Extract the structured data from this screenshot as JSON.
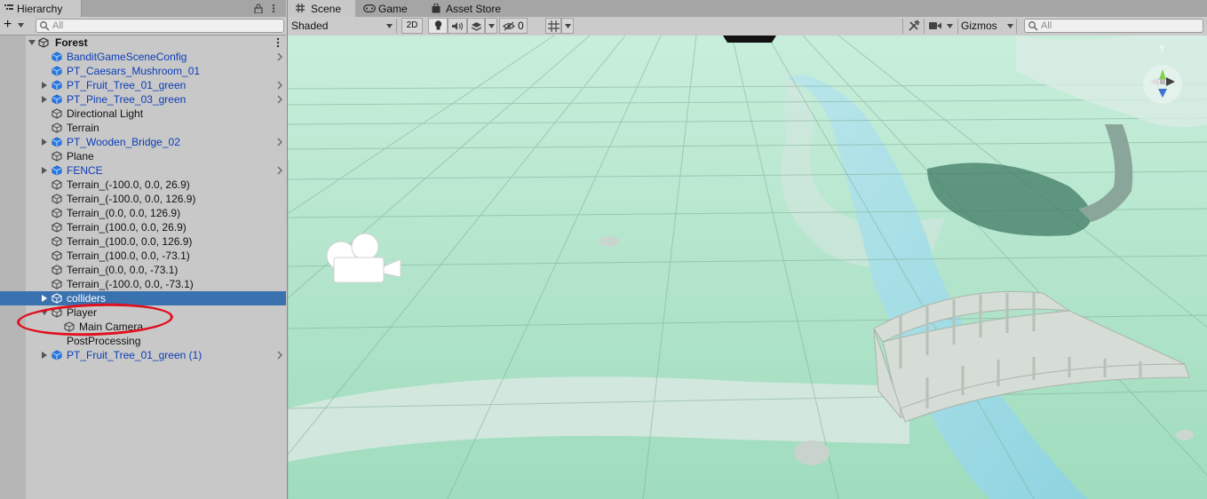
{
  "hierarchy": {
    "tab_label": "Hierarchy",
    "search_placeholder": "All",
    "add_label": "+",
    "scene_name": "Forest",
    "items": [
      {
        "label": "BanditGameSceneConfig",
        "prefab": true,
        "expandable": false,
        "chevron": true,
        "selected": false
      },
      {
        "label": "PT_Caesars_Mushroom_01",
        "prefab": true,
        "expandable": false,
        "chevron": false,
        "selected": false
      },
      {
        "label": "PT_Fruit_Tree_01_green",
        "prefab": true,
        "expandable": true,
        "chevron": true,
        "selected": false
      },
      {
        "label": "PT_Pine_Tree_03_green",
        "prefab": true,
        "expandable": true,
        "chevron": true,
        "selected": false
      },
      {
        "label": "Directional Light",
        "prefab": false,
        "expandable": false,
        "chevron": false,
        "selected": false
      },
      {
        "label": "Terrain",
        "prefab": false,
        "expandable": false,
        "chevron": false,
        "selected": false
      },
      {
        "label": "PT_Wooden_Bridge_02",
        "prefab": true,
        "expandable": true,
        "chevron": true,
        "selected": false
      },
      {
        "label": "Plane",
        "prefab": false,
        "expandable": false,
        "chevron": false,
        "selected": false
      },
      {
        "label": "FENCE",
        "prefab": true,
        "expandable": true,
        "chevron": true,
        "selected": false
      },
      {
        "label": "Terrain_(-100.0, 0.0, 26.9)",
        "prefab": false,
        "expandable": false,
        "chevron": false,
        "selected": false
      },
      {
        "label": "Terrain_(-100.0, 0.0, 126.9)",
        "prefab": false,
        "expandable": false,
        "chevron": false,
        "selected": false
      },
      {
        "label": "Terrain_(0.0, 0.0, 126.9)",
        "prefab": false,
        "expandable": false,
        "chevron": false,
        "selected": false
      },
      {
        "label": "Terrain_(100.0, 0.0, 26.9)",
        "prefab": false,
        "expandable": false,
        "chevron": false,
        "selected": false
      },
      {
        "label": "Terrain_(100.0, 0.0, 126.9)",
        "prefab": false,
        "expandable": false,
        "chevron": false,
        "selected": false
      },
      {
        "label": "Terrain_(100.0, 0.0, -73.1)",
        "prefab": false,
        "expandable": false,
        "chevron": false,
        "selected": false
      },
      {
        "label": "Terrain_(0.0, 0.0, -73.1)",
        "prefab": false,
        "expandable": false,
        "chevron": false,
        "selected": false
      },
      {
        "label": "Terrain_(-100.0, 0.0, -73.1)",
        "prefab": false,
        "expandable": false,
        "chevron": false,
        "selected": false
      },
      {
        "label": "colliders",
        "prefab": false,
        "expandable": true,
        "chevron": false,
        "selected": true
      },
      {
        "label": "Player",
        "prefab": false,
        "expandable": true,
        "expanded": true,
        "chevron": false,
        "selected": false
      },
      {
        "label": "Main Camera",
        "prefab": false,
        "expandable": false,
        "chevron": false,
        "selected": false,
        "child": true
      },
      {
        "label": "PostProcessing",
        "prefab": false,
        "expandable": false,
        "chevron": false,
        "selected": false,
        "noicon": true
      },
      {
        "label": "PT_Fruit_Tree_01_green (1)",
        "prefab": true,
        "expandable": true,
        "chevron": true,
        "selected": false
      }
    ],
    "annotation_color": "#e0101f"
  },
  "scene": {
    "tabs": [
      {
        "label": "Scene",
        "icon": "grid-icon",
        "active": true
      },
      {
        "label": "Game",
        "icon": "gamepad-icon",
        "active": false
      },
      {
        "label": "Asset Store",
        "icon": "bag-icon",
        "active": false
      }
    ],
    "shading_mode": "Shaded",
    "toggle_2d": "2D",
    "hidden_count": "0",
    "gizmos_label": "Gizmos",
    "search_placeholder": "All",
    "gizmo_axis_y": "y"
  },
  "colors": {
    "selection": "#3a72b0",
    "prefab_text": "#0b3db8",
    "terrain": "#aee3c9",
    "river": "#a9dde6"
  }
}
